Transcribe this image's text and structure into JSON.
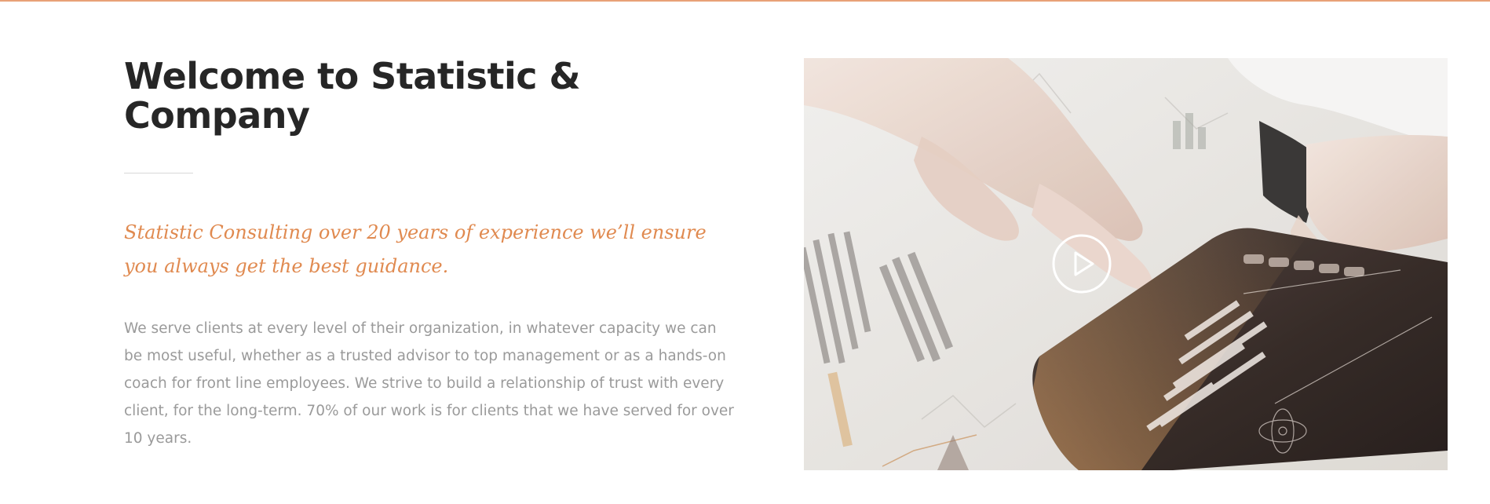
{
  "intro": {
    "title": "Welcome to Statistic & Company",
    "tagline": "Statistic Consulting over 20 years of experience we’ll ensure you always get the best guidance.",
    "body": "We serve clients at every level of their organization, in whatever capacity we can be most useful, whether as a trusted advisor to top management or as a hands-on coach for front line employees. We strive to build a relationship of trust with every client, for the long-term. 70% of our work is for clients that we have served for over 10 years."
  },
  "colors": {
    "accent": "#e08a50",
    "heading": "#262626",
    "body_text": "#9a9a9a",
    "top_border": "#e8a177"
  },
  "media": {
    "icon": "play-icon"
  }
}
